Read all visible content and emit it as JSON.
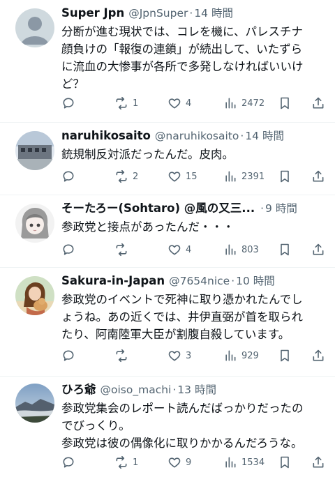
{
  "tweets": [
    {
      "name": "Super Jpn",
      "handle": "@JpnSuper",
      "dot": "·",
      "time": "14 時間",
      "text": "分断が進む現状では、コレを機に、パレスチナ\n顔負けの「報復の連鎖」が続出して、いたずら\nに流血の大惨事が各所で多発しなければいいけ\nど？",
      "retweets": "1",
      "likes": "4",
      "views": "2472"
    },
    {
      "name": "naruhikosaito",
      "handle": "@naruhikosaito",
      "dot": "·",
      "time": "14 時間",
      "text": "銃規制反対派だったんだ。皮肉。",
      "retweets": "2",
      "likes": "15",
      "views": "2391"
    },
    {
      "name": "そーたろー(Sohtaro) @風の又三...",
      "handle": "",
      "dot": "·",
      "time": "9 時間",
      "text": "参政党と接点があったんだ・・・",
      "retweets": "",
      "likes": "4",
      "views": "803"
    },
    {
      "name": "Sakura-in-Japan",
      "handle": "@7654nice",
      "dot": "·",
      "time": "10 時間",
      "text": "参政党のイベントで死神に取り憑かれたんでし\nょうね。あの近くでは、井伊直弼が首を取られ\nたり、阿南陸軍大臣が割腹自殺しています。",
      "retweets": "",
      "likes": "3",
      "views": "929"
    },
    {
      "name": "ひろ爺",
      "handle": "@oiso_machi",
      "dot": "·",
      "time": "13 時間",
      "text": "参政党集会のレポート読んだばっかりだったの\nでびっくり。\n参政党は彼の偶像化に取りかかるんだろうな。",
      "retweets": "1",
      "likes": "9",
      "views": "1534"
    }
  ],
  "icons": {
    "reply": "reply-icon",
    "retweet": "retweet-icon",
    "like": "heart-icon",
    "views": "views-icon",
    "bookmark": "bookmark-icon",
    "share": "share-icon"
  },
  "colors": {
    "text": "#0f1419",
    "muted": "#536471",
    "divider": "#eff3f4"
  }
}
